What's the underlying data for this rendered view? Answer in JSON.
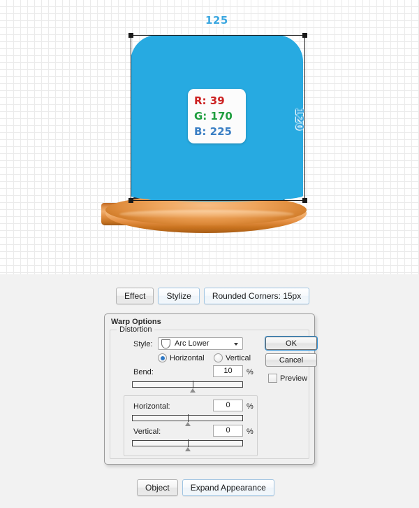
{
  "canvas": {
    "dimension_width_label": "125",
    "dimension_height_label": "120",
    "artwork_fill_hex": "#27AAE1",
    "base_fill_hex": "#E08E3F",
    "rgb_callout": {
      "r": "R: 39",
      "g": "G: 170",
      "b": "B: 225"
    }
  },
  "breadcrumb_top": {
    "items": [
      {
        "label": "Effect",
        "accent": false
      },
      {
        "label": "Stylize",
        "accent": true
      },
      {
        "label": "Rounded Corners: 15px",
        "accent": true
      }
    ]
  },
  "breadcrumb_bottom": {
    "items": [
      {
        "label": "Object",
        "accent": false
      },
      {
        "label": "Expand Appearance",
        "accent": true
      }
    ]
  },
  "warp_dialog": {
    "title": "Warp Options",
    "style": {
      "label": "Style:",
      "value": "Arc Lower",
      "icon": "arc-lower-icon",
      "dropdown_icon": "chevron-down-icon"
    },
    "orientation": {
      "horizontal_label": "Horizontal",
      "vertical_label": "Vertical",
      "selected": "Horizontal"
    },
    "bend": {
      "label": "Bend:",
      "value": "10",
      "unit": "%",
      "slider_percent": 55
    },
    "distortion": {
      "legend": "Distortion",
      "horizontal": {
        "label": "Horizontal:",
        "value": "0",
        "unit": "%",
        "slider_percent": 50
      },
      "vertical": {
        "label": "Vertical:",
        "value": "0",
        "unit": "%",
        "slider_percent": 50
      }
    },
    "buttons": {
      "ok": "OK",
      "cancel": "Cancel"
    },
    "preview": {
      "label": "Preview",
      "checked": false
    }
  }
}
